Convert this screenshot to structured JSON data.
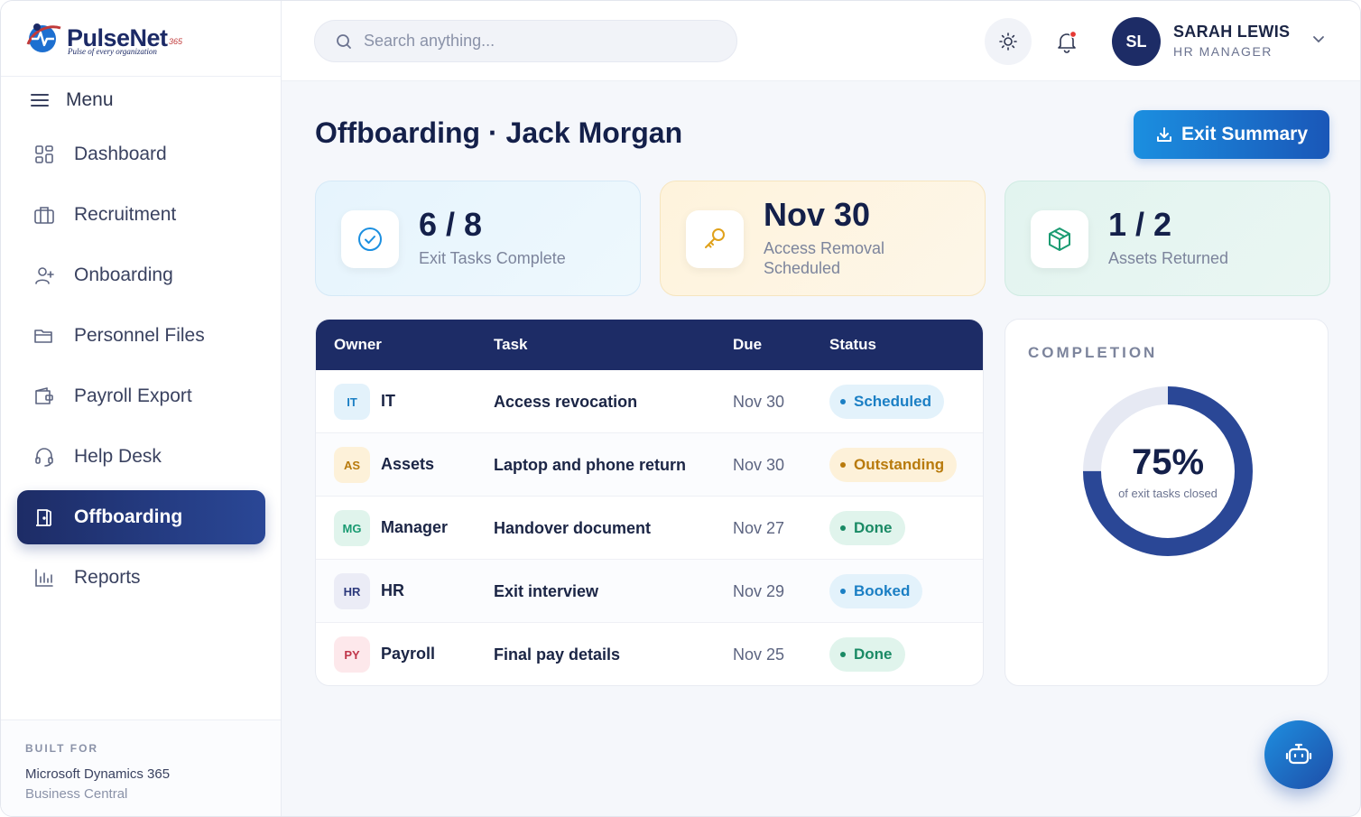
{
  "brand": {
    "name": "PulseNet",
    "sup": "365",
    "tagline": "Pulse of every organization"
  },
  "sidebar": {
    "menu_label": "Menu",
    "items": [
      {
        "label": "Dashboard",
        "icon": "dashboard-icon"
      },
      {
        "label": "Recruitment",
        "icon": "briefcase-icon"
      },
      {
        "label": "Onboarding",
        "icon": "user-plus-icon"
      },
      {
        "label": "Personnel Files",
        "icon": "folder-icon"
      },
      {
        "label": "Payroll Export",
        "icon": "wallet-icon"
      },
      {
        "label": "Help Desk",
        "icon": "headset-icon"
      },
      {
        "label": "Offboarding",
        "icon": "door-exit-icon",
        "active": true
      },
      {
        "label": "Reports",
        "icon": "bar-chart-icon"
      }
    ],
    "built_for": {
      "label": "BUILT FOR",
      "product": "Microsoft Dynamics 365",
      "edition": "Business Central"
    }
  },
  "topbar": {
    "search_placeholder": "Search anything...",
    "user": {
      "initials": "SL",
      "name": "SARAH LEWIS",
      "role": "HR MANAGER"
    }
  },
  "page": {
    "title": "Offboarding · Jack Morgan",
    "action_label": "Exit Summary"
  },
  "stats": [
    {
      "value": "6 / 8",
      "caption": "Exit Tasks Complete",
      "icon": "check-circle-icon",
      "color": "#1b8fe0"
    },
    {
      "value": "Nov 30",
      "caption": "Access Removal Scheduled",
      "icon": "key-icon",
      "color": "#e0a11b"
    },
    {
      "value": "1 / 2",
      "caption": "Assets Returned",
      "icon": "box-icon",
      "color": "#1a9b72"
    }
  ],
  "table": {
    "headers": {
      "owner": "Owner",
      "task": "Task",
      "due": "Due",
      "status": "Status"
    },
    "rows": [
      {
        "badge": "IT",
        "owner": "IT",
        "task": "Access revocation",
        "due": "Nov 30",
        "status": "Scheduled",
        "tone": "blue"
      },
      {
        "badge": "AS",
        "owner": "Assets",
        "task": "Laptop and phone return",
        "due": "Nov 30",
        "status": "Outstanding",
        "tone": "amber"
      },
      {
        "badge": "MG",
        "owner": "Manager",
        "task": "Handover document",
        "due": "Nov 27",
        "status": "Done",
        "tone": "green"
      },
      {
        "badge": "HR",
        "owner": "HR",
        "task": "Exit interview",
        "due": "Nov 29",
        "status": "Booked",
        "tone": "blue"
      },
      {
        "badge": "PY",
        "owner": "Payroll",
        "task": "Final pay details",
        "due": "Nov 25",
        "status": "Done",
        "tone": "green"
      }
    ]
  },
  "completion": {
    "title": "COMPLETION",
    "percent": 75,
    "percent_label": "75%",
    "caption": "of exit tasks closed"
  },
  "colors": {
    "navy": "#1d2c66",
    "accent": "#1b8fe0",
    "donut": "#2a4796",
    "donut_track": "#e6e9f3"
  }
}
